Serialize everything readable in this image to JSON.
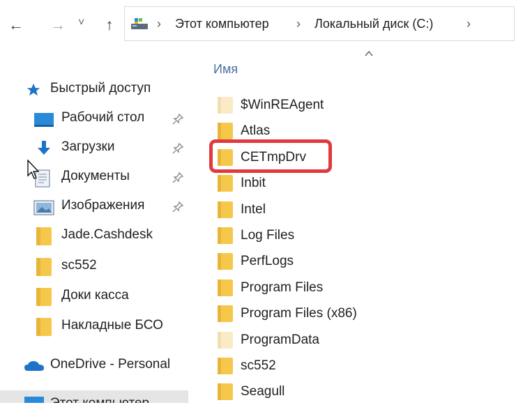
{
  "nav": {
    "back_icon": "←",
    "forward_icon": "→",
    "recent_icon": "˅",
    "up_icon": "↑"
  },
  "address": {
    "crumbs": [
      "Этот компьютер",
      "Локальный диск (C:)"
    ],
    "separator": "›"
  },
  "columns": {
    "name": "Имя"
  },
  "sidebar": {
    "quick_access": "Быстрый доступ",
    "items": [
      {
        "label": "Рабочий стол",
        "icon": "desktop-icon",
        "pinned": true
      },
      {
        "label": "Загрузки",
        "icon": "download-icon",
        "pinned": true
      },
      {
        "label": "Документы",
        "icon": "documents-icon",
        "pinned": true
      },
      {
        "label": "Изображения",
        "icon": "pictures-icon",
        "pinned": true
      },
      {
        "label": "Jade.Cashdesk",
        "icon": "folder-icon",
        "pinned": false
      },
      {
        "label": "sc552",
        "icon": "folder-icon",
        "pinned": false
      },
      {
        "label": "Доки касса",
        "icon": "folder-icon",
        "pinned": false
      },
      {
        "label": "Накладные БСО",
        "icon": "folder-icon",
        "pinned": false
      }
    ],
    "onedrive": "OneDrive - Personal",
    "this_pc": "Этот компьютер"
  },
  "files": [
    {
      "name": "$WinREAgent",
      "hidden": true
    },
    {
      "name": "Atlas",
      "hidden": false
    },
    {
      "name": "CETmpDrv",
      "hidden": false,
      "highlighted": true
    },
    {
      "name": "Inbit",
      "hidden": false
    },
    {
      "name": "Intel",
      "hidden": false
    },
    {
      "name": "Log Files",
      "hidden": false
    },
    {
      "name": "PerfLogs",
      "hidden": false
    },
    {
      "name": "Program Files",
      "hidden": false
    },
    {
      "name": "Program Files (x86)",
      "hidden": false
    },
    {
      "name": "ProgramData",
      "hidden": true
    },
    {
      "name": "sc552",
      "hidden": false
    },
    {
      "name": "Seagull",
      "hidden": false
    }
  ],
  "colors": {
    "folder": "#f5c84c",
    "folder_hidden": "#faebc6",
    "highlight": "#e0393e",
    "accent_blue": "#1e73c8"
  }
}
